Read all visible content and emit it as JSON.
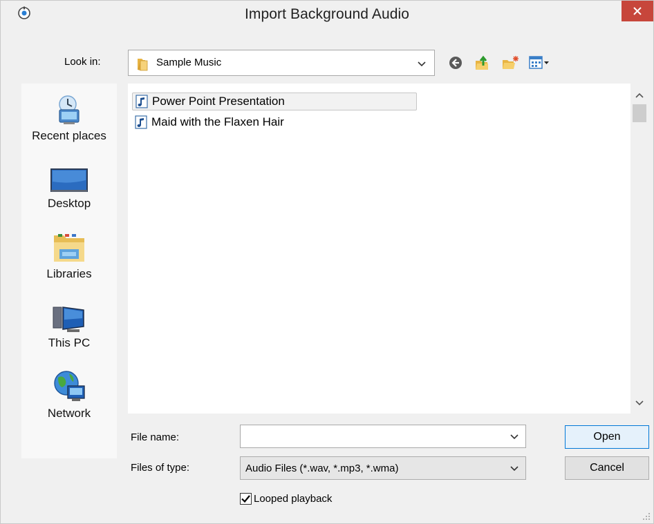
{
  "dialog": {
    "title": "Import Background Audio",
    "close_label": "×"
  },
  "lookin": {
    "label": "Look in:",
    "value": "Sample Music"
  },
  "toolbar": {
    "icons": [
      "back-icon",
      "up-folder-icon",
      "new-folder-icon",
      "view-menu-icon"
    ]
  },
  "places": [
    {
      "label": "Recent places",
      "icon": "recent-places-icon"
    },
    {
      "label": "Desktop",
      "icon": "desktop-icon"
    },
    {
      "label": "Libraries",
      "icon": "libraries-icon"
    },
    {
      "label": "This PC",
      "icon": "this-pc-icon"
    },
    {
      "label": "Network",
      "icon": "network-icon"
    }
  ],
  "files": [
    {
      "name": "Power Point Presentation",
      "selected": true
    },
    {
      "name": "Maid with the Flaxen Hair",
      "selected": false
    }
  ],
  "filename": {
    "label": "File name:",
    "value": ""
  },
  "filetype": {
    "label": "Files of type:",
    "value": "Audio Files (*.wav, *.mp3, *.wma)"
  },
  "buttons": {
    "open": "Open",
    "cancel": "Cancel"
  },
  "looped": {
    "label": "Looped playback",
    "checked": true
  },
  "colors": {
    "close_bg": "#c7463b",
    "default_button_border": "#0078d7"
  }
}
